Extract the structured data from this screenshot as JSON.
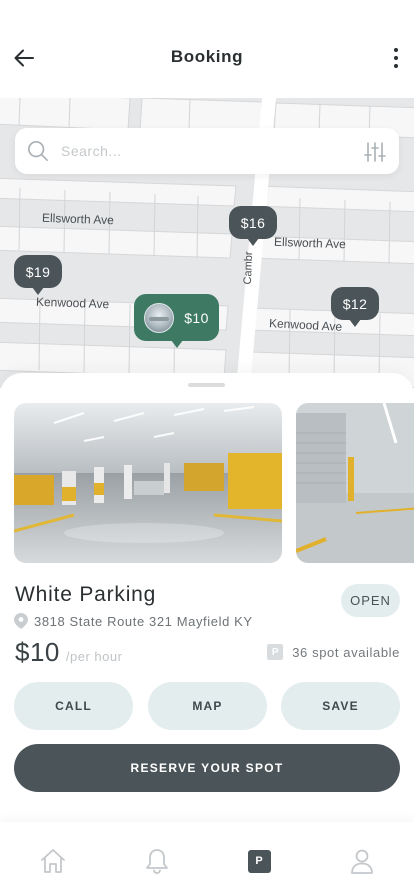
{
  "header": {
    "title": "Booking",
    "back_icon": "arrow-left-icon",
    "menu_icon": "more-vertical-icon"
  },
  "map": {
    "search": {
      "placeholder": "Search...",
      "icon": "search-icon",
      "filter_icon": "sliders-icon"
    },
    "streets": [
      "Ellsworth Ave",
      "Ellsworth Ave",
      "Kenwood Ave",
      "Kenwood Ave",
      "Cambr"
    ],
    "pins": [
      {
        "label": "$16",
        "selected": false
      },
      {
        "label": "$19",
        "selected": false
      },
      {
        "label": "$10",
        "selected": true
      },
      {
        "label": "$12",
        "selected": false
      }
    ]
  },
  "listing": {
    "name": "White Parking",
    "status": "OPEN",
    "address": "3818 State Route 321 Mayfield KY",
    "price": "$10",
    "price_unit": "/per hour",
    "parking_badge": "P",
    "spots": "36 spot available",
    "actions": {
      "call": "CALL",
      "map": "MAP",
      "save": "SAVE"
    },
    "reserve": "RESERVE YOUR SPOT"
  },
  "bottom_nav": {
    "items": [
      {
        "icon": "home-icon",
        "active": false
      },
      {
        "icon": "bell-icon",
        "active": false
      },
      {
        "icon": "parking-icon",
        "label": "P",
        "active": true
      },
      {
        "icon": "user-icon",
        "active": false
      }
    ]
  },
  "colors": {
    "primary": "#4b5458",
    "pin_selected": "#3e7a63",
    "button_light": "#e3edee",
    "map_bg": "#e6e7e8"
  }
}
